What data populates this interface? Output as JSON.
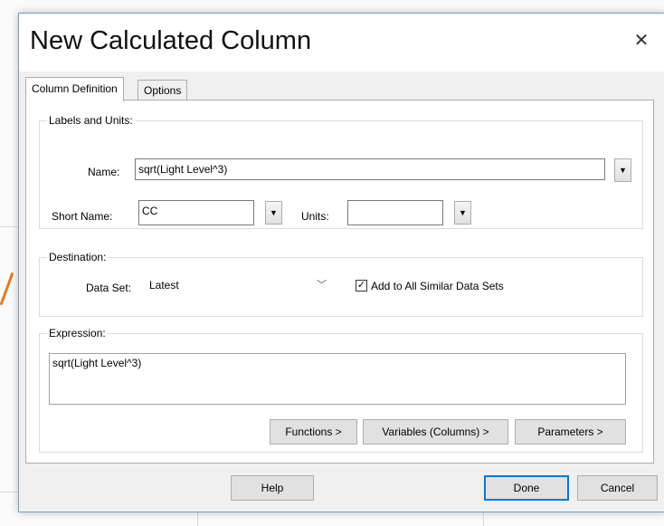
{
  "dialog": {
    "title": "New Calculated Column",
    "close_glyph": "✕"
  },
  "tabs": [
    {
      "label": "Column Definition",
      "active": true
    },
    {
      "label": "Options",
      "active": false
    }
  ],
  "labels_units": {
    "legend": "Labels and Units:",
    "name_label": "Name:",
    "name_value": "sqrt(Light Level^3)",
    "short_name_label": "Short Name:",
    "short_name_value": "CC",
    "units_label": "Units:",
    "units_value": ""
  },
  "destination": {
    "legend": "Destination:",
    "data_set_label": "Data Set:",
    "data_set_value": "Latest",
    "add_all_label": "Add to All Similar Data Sets",
    "add_all_checked": true
  },
  "expression": {
    "legend": "Expression:",
    "value": "sqrt(Light Level^3)",
    "functions_button": "Functions >",
    "variables_button": "Variables (Columns) >",
    "parameters_button": "Parameters >"
  },
  "footer": {
    "help_button": "Help",
    "done_button": "Done",
    "cancel_button": "Cancel"
  },
  "icons": {
    "dropdown": "▼",
    "chevron": "﹀",
    "check": "✓"
  }
}
